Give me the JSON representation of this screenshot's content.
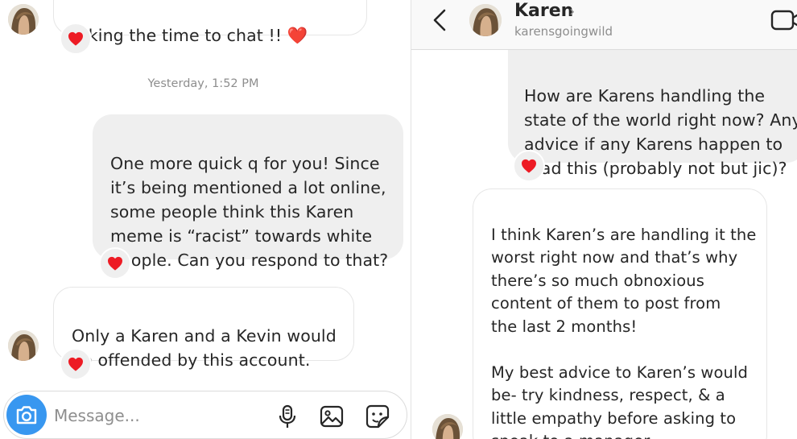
{
  "left_thread": {
    "top_partial_message": "taking the time to chat !! ❤️",
    "timestamp": "Yesterday, 1:52 PM",
    "sent_message": "One more quick q for you! Since\nit’s being mentioned a lot online,\nsome people think this Karen\nmeme is “racist” towards white\npeople. Can you respond to that?",
    "received_message": "Only a Karen and a Kevin would\nbe offended by this account.",
    "composer": {
      "placeholder": "Message...",
      "icons": [
        "camera-icon",
        "microphone-icon",
        "gallery-icon",
        "sticker-icon"
      ]
    }
  },
  "right_thread": {
    "header": {
      "name": "Karen",
      "chevron": "›",
      "username": "karensgoingwild",
      "icons": [
        "back-arrow-icon",
        "video-call-icon"
      ]
    },
    "sent_message": "How are Karens handling the\nstate of the world right now? Any\nadvice if any Karens happen to\nread this (probably not but jic)?",
    "received_message": "I think Karen’s are handling it the\nworst right now and that’s why\nthere’s so much obnoxious\ncontent of them to post from\nthe last 2 months!\n\nMy best advice to Karen’s would\nbe- try kindness, respect, & a\nlittle empathy before asking to\nspeak to a manager."
  },
  "colors": {
    "sent_bubble": "#efefef",
    "received_border": "#e6e6e6",
    "heart": "#ed1b24",
    "camera_button": "#3897f0",
    "secondary_text": "#8e8e8e"
  }
}
